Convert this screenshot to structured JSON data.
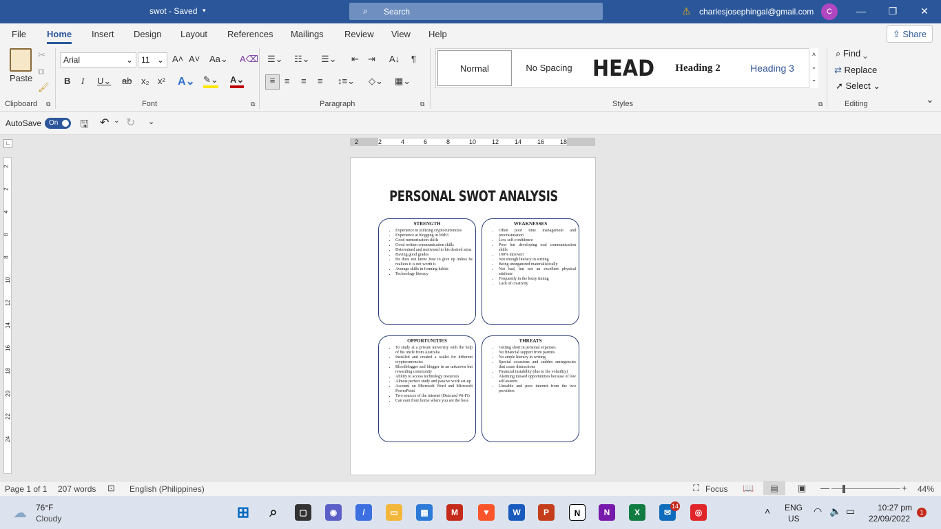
{
  "titlebar": {
    "doc_title": "swot - Saved",
    "search_label": "Search",
    "account": "charlesjosephingal@gmail.com",
    "avatar_initial": "C"
  },
  "menu": {
    "tabs": [
      "File",
      "Home",
      "Insert",
      "Design",
      "Layout",
      "References",
      "Mailings",
      "Review",
      "View",
      "Help"
    ],
    "active": "Home",
    "share": "Share"
  },
  "ribbon": {
    "clipboard": {
      "paste": "Paste",
      "label": "Clipboard"
    },
    "font": {
      "name": "Arial",
      "size": "11",
      "label": "Font"
    },
    "paragraph": {
      "label": "Paragraph"
    },
    "styles": {
      "label": "Styles",
      "items": [
        "Normal",
        "No Spacing",
        "HEAD",
        "Heading 2",
        "Heading 3"
      ]
    },
    "editing": {
      "label": "Editing",
      "find": "Find",
      "replace": "Replace",
      "select": "Select"
    }
  },
  "qat": {
    "autosave": "AutoSave",
    "toggle": "On"
  },
  "ruler": {
    "h_ticks": [
      "2",
      "2",
      "4",
      "6",
      "8",
      "10",
      "12",
      "14",
      "16",
      "18"
    ],
    "v_ticks": [
      "2",
      "2",
      "4",
      "6",
      "8",
      "10",
      "12",
      "14",
      "16",
      "18",
      "20",
      "22",
      "24"
    ]
  },
  "document": {
    "title": "PERSONAL SWOT ANALYSIS",
    "strength": {
      "heading": "STRENGTH",
      "items": [
        "Experience in utilizing cryptocurrencies",
        "Experience at blogging in Web3",
        "Good memorization skills",
        "Good written communication skills",
        "Determined and motivated to his desired aims",
        "Having good grades",
        "He does not know how to give up unless he realizes it is not worth it.",
        "Average skills in forming habits",
        "Technology literacy"
      ]
    },
    "weaknesses": {
      "heading": "WEAKNESSES",
      "items": [
        "Often poor time management and procrastination",
        "Low self-confidence",
        "Poor but developing oral communication skills",
        "100% introvert",
        "Not enough literacy in writing",
        "Being unorganized materialistically",
        "Not bad, but not an excellent physical attribute",
        "Frequently in the lousy timing",
        "Lack of creativity"
      ]
    },
    "opportunities": {
      "heading": "OPPORTUNITIES",
      "items": [
        "To study at a private university with the help of his uncle from Australia",
        "Installed and created a wallet for different cryptocurrencies",
        "Bloodblogger and blogger in an unknown but rewarding community",
        "Ability to access technology resources",
        "Almost perfect study and passive work set-up",
        "Account on Microsoft Word and Microsoft PowerPoint",
        "Two sources of the internet (Data and Wi-Fi)",
        "Can earn from home where you are the boss"
      ]
    },
    "threats": {
      "heading": "THREATS",
      "items": [
        "Getting short in personal expenses",
        "No financial support from parents",
        "No ample literacy in writing",
        "Special occasions and sudden emergencies that cause distractions",
        "Financial instability (due to the volatility)",
        "Alarming missed opportunities because of low self-esteem",
        "Unstable and poor internet from the two providers"
      ]
    }
  },
  "status": {
    "page": "Page 1 of 1",
    "words": "207 words",
    "language": "English (Philippines)",
    "focus": "Focus",
    "zoom": "44%"
  },
  "taskbar": {
    "weather_temp": "76°F",
    "weather_desc": "Cloudy",
    "lang": "ENG",
    "region": "US",
    "time": "10:27 pm",
    "date": "22/09/2022",
    "mail_badge": "14",
    "notif_badge": "1"
  }
}
